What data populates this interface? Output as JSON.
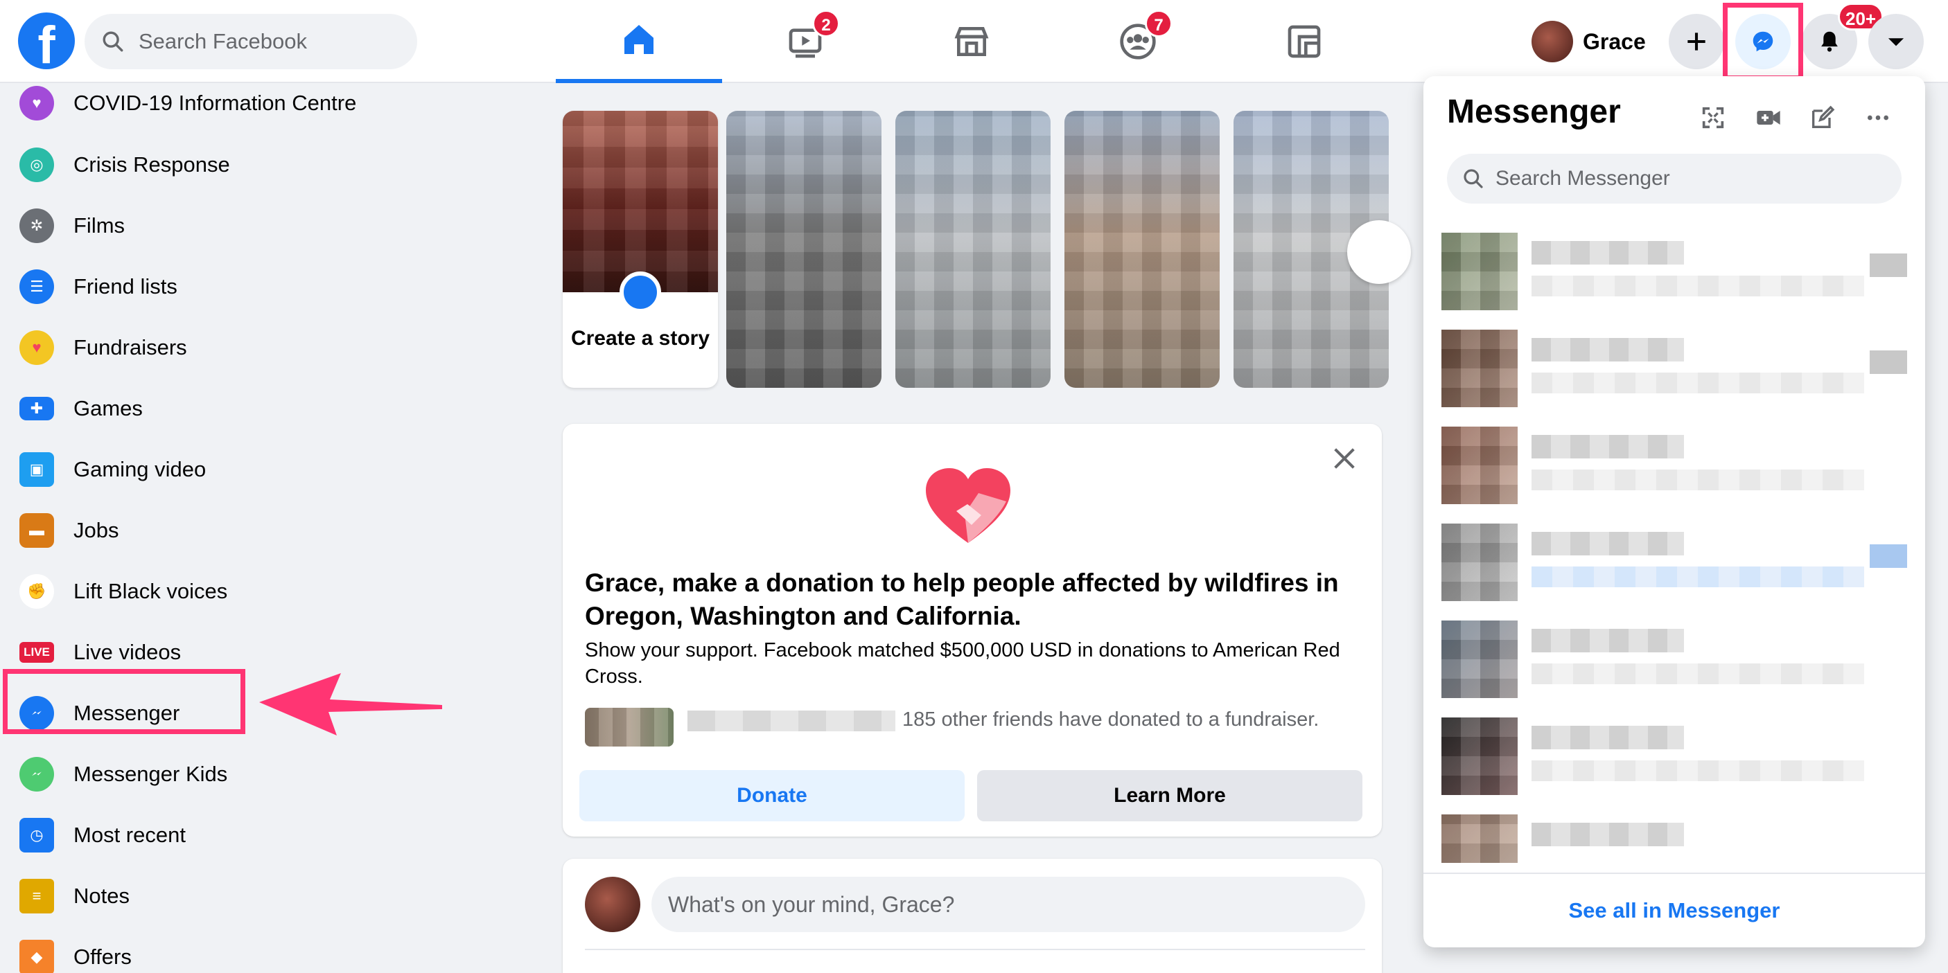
{
  "header": {
    "logo_letter": "f",
    "search_placeholder": "Search Facebook",
    "nav": [
      {
        "name": "home",
        "badge": ""
      },
      {
        "name": "watch",
        "badge": "2"
      },
      {
        "name": "marketplace",
        "badge": ""
      },
      {
        "name": "groups",
        "badge": "7"
      },
      {
        "name": "gaming",
        "badge": ""
      }
    ],
    "profile_name": "Grace",
    "notifications_badge": "20+"
  },
  "sidebar": {
    "items": [
      {
        "label": "COVID-19 Information Centre",
        "icon": "covid-icon",
        "color": "#a24bd8"
      },
      {
        "label": "Crisis Response",
        "icon": "crisis-response-icon",
        "color": "#2abba7"
      },
      {
        "label": "Films",
        "icon": "film-reel-icon",
        "color": "#6b6f75"
      },
      {
        "label": "Friend lists",
        "icon": "friend-lists-icon",
        "color": "#1877f2"
      },
      {
        "label": "Fundraisers",
        "icon": "heart-icon",
        "color": "#f3425f"
      },
      {
        "label": "Games",
        "icon": "games-icon",
        "color": "#1877f2"
      },
      {
        "label": "Gaming video",
        "icon": "gaming-video-icon",
        "color": "#1e9ef0"
      },
      {
        "label": "Jobs",
        "icon": "briefcase-icon",
        "color": "#d97a16"
      },
      {
        "label": "Lift Black voices",
        "icon": "raised-fist-icon",
        "color": "#111111"
      },
      {
        "label": "Live videos",
        "icon": "live-icon",
        "color": "#e41e3f",
        "tag": "LIVE"
      },
      {
        "label": "Messenger",
        "icon": "messenger-icon",
        "color": "#1877f2"
      },
      {
        "label": "Messenger Kids",
        "icon": "messenger-kids-icon",
        "color": "#4ecb71"
      },
      {
        "label": "Most recent",
        "icon": "most-recent-icon",
        "color": "#1877f2"
      },
      {
        "label": "Notes",
        "icon": "notes-icon",
        "color": "#e0a800"
      },
      {
        "label": "Offers",
        "icon": "offers-icon",
        "color": "#f5822a"
      }
    ]
  },
  "stories": {
    "create_label": "Create a story"
  },
  "fundraiser": {
    "title": "Grace, make a donation to help people affected by wildfires in Oregon, Washington and California.",
    "subtitle": "Show your support. Facebook matched $500,000 USD in donations to American Red Cross.",
    "friends_text": "185 other friends have donated to a fundraiser.",
    "donate_label": "Donate",
    "learn_more_label": "Learn More"
  },
  "composer": {
    "placeholder": "What's on your mind, Grace?"
  },
  "messenger": {
    "title": "Messenger",
    "search_placeholder": "Search Messenger",
    "see_all_label": "See all in Messenger"
  },
  "colors": {
    "brand": "#1877f2",
    "annotation": "#ff3573",
    "badge": "#e41e3f"
  }
}
